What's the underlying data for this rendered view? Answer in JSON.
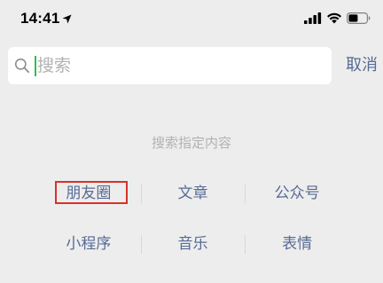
{
  "status_bar": {
    "time": "14:41",
    "icons": [
      "location-arrow-icon",
      "cellular-signal-icon",
      "wifi-icon",
      "battery-icon"
    ]
  },
  "search": {
    "placeholder": "搜索",
    "cancel_label": "取消",
    "icon": "search-icon",
    "caret_color": "#2fbf4a"
  },
  "hint": {
    "text": "搜索指定内容"
  },
  "categories": {
    "row1": [
      {
        "label": "朋友圈",
        "highlighted": true
      },
      {
        "label": "文章"
      },
      {
        "label": "公众号"
      }
    ],
    "row2": [
      {
        "label": "小程序"
      },
      {
        "label": "音乐"
      },
      {
        "label": "表情"
      }
    ]
  },
  "colors": {
    "background": "#ededed",
    "link": "#576b95",
    "placeholder": "#b2b2b2",
    "highlight_border": "#d9312b"
  }
}
